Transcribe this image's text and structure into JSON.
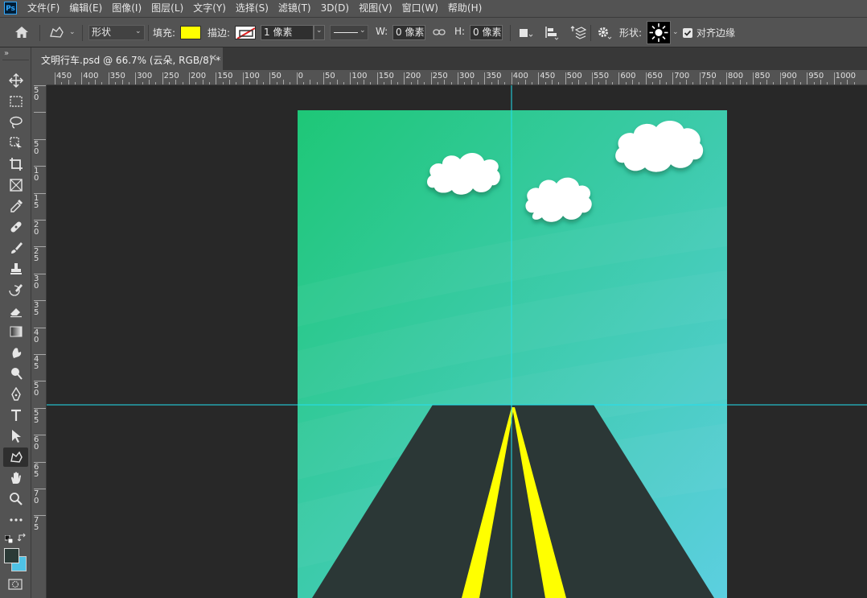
{
  "app": {
    "logo": "Ps"
  },
  "menu": [
    "文件(F)",
    "编辑(E)",
    "图像(I)",
    "图层(L)",
    "文字(Y)",
    "选择(S)",
    "滤镜(T)",
    "3D(D)",
    "视图(V)",
    "窗口(W)",
    "帮助(H)"
  ],
  "options": {
    "mode_value": "形状",
    "fill_label": "填充:",
    "fill_color": "#ffff00",
    "stroke_label": "描边:",
    "stroke_width": "1 像素",
    "w_label": "W:",
    "w_value": "0 像素",
    "h_label": "H:",
    "h_value": "0 像素",
    "shape_label": "形状:",
    "align_edges_label": "对齐边缘",
    "align_edges_checked": true
  },
  "document": {
    "tab_title": "文明行车.psd @ 66.7% (云朵, RGB/8) *"
  },
  "rulers": {
    "horizontal": [
      "450",
      "400",
      "350",
      "300",
      "250",
      "200",
      "150",
      "100",
      "50",
      "0",
      "50",
      "100",
      "150",
      "200",
      "250",
      "300",
      "350",
      "400",
      "450",
      "500",
      "550",
      "600",
      "650",
      "700",
      "750",
      "800",
      "850",
      "900",
      "950",
      "1000"
    ],
    "vertical": [
      "50",
      "",
      "50",
      "10",
      "15",
      "20",
      "25",
      "30",
      "35",
      "40",
      "45",
      "50",
      "55",
      "60",
      "65",
      "70",
      "75"
    ]
  },
  "toolbar": {
    "tools": [
      "move-icon",
      "marquee-icon",
      "lasso-icon",
      "quick-select-icon",
      "crop-icon",
      "frame-icon",
      "eyedropper-icon",
      "healing-icon",
      "brush-icon",
      "stamp-icon",
      "history-brush-icon",
      "eraser-icon",
      "gradient-icon",
      "smudge-icon",
      "dodge-icon",
      "pen-icon",
      "type-icon",
      "path-select-icon",
      "custom-shape-icon",
      "hand-icon",
      "zoom-icon",
      "more-icon"
    ],
    "active_tool": "custom-shape-icon",
    "foreground_color": "#2b3a37",
    "background_color": "#4fc3e6"
  },
  "artwork": {
    "sky_top": "#1ec777",
    "sky_bottom": "#5ccfe0",
    "road_color": "#2b3736",
    "line_color": "#ffff00",
    "cloud_color": "#ffffff",
    "guide_color": "#22e0f0"
  }
}
